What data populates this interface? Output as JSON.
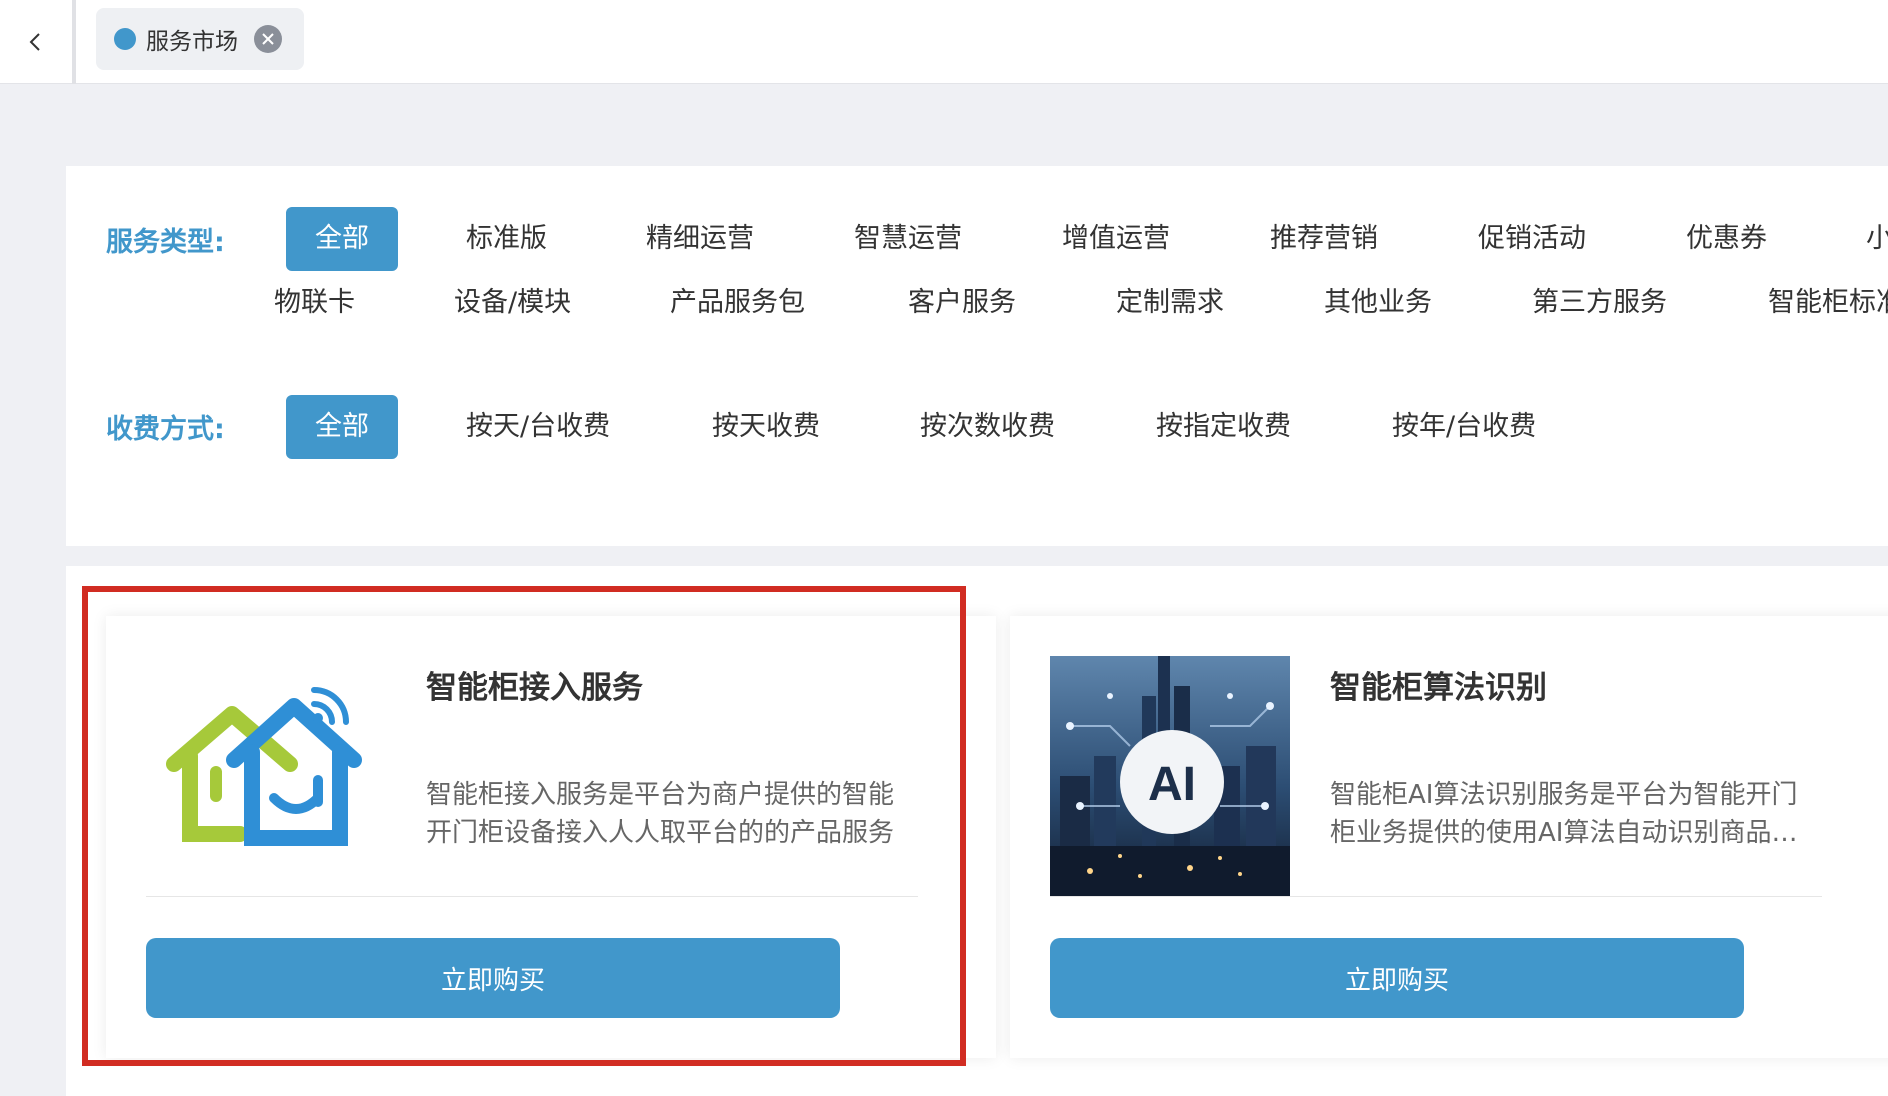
{
  "tabs": [
    {
      "label": "服务市场",
      "active": true
    }
  ],
  "filters": {
    "service_type": {
      "label": "服务类型:",
      "options": [
        "全部",
        "标准版",
        "精细运营",
        "智慧运营",
        "增值运营",
        "推荐营销",
        "促销活动",
        "优惠券",
        "小",
        "物联卡",
        "设备/模块",
        "产品服务包",
        "客户服务",
        "定制需求",
        "其他业务",
        "第三方服务",
        "智能柜标准"
      ],
      "selected": "全部"
    },
    "billing_method": {
      "label": "收费方式:",
      "options": [
        "全部",
        "按天/台收费",
        "按天收费",
        "按次数收费",
        "按指定收费",
        "按年/台收费"
      ],
      "selected": "全部"
    }
  },
  "products": [
    {
      "title": "智能柜接入服务",
      "description": "智能柜接入服务是平台为商户提供的智能开门柜设备接入人人取平台的的产品服务",
      "buy_label": "立即购买",
      "thumbnail": "smart-home-icon",
      "highlighted": true
    },
    {
      "title": "智能柜算法识别",
      "description": "智能柜AI算法识别服务是平台为智能开门柜业务提供的使用AI算法自动识别商品的服务",
      "buy_label": "立即购买",
      "thumbnail": "ai-city-image"
    }
  ],
  "colors": {
    "accent": "#4197cb",
    "highlight": "#d12c22",
    "background": "#eff0f4"
  }
}
